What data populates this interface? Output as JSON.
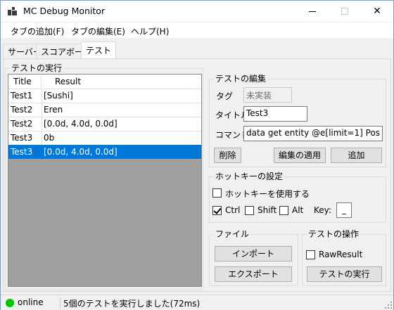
{
  "window": {
    "title": "MC Debug Monitor"
  },
  "menu": [
    "タブの追加(F)",
    "タブの編集(E)",
    "ヘルプ(H)"
  ],
  "tabs": [
    "サーバー",
    "スコアボード",
    "テスト"
  ],
  "run_group": {
    "label": "テストの実行",
    "columns": [
      "Title",
      "Result"
    ],
    "rows": [
      {
        "title": "Test1",
        "result": "[Sushi]",
        "selected": false
      },
      {
        "title": "Test2",
        "result": "Eren",
        "selected": false
      },
      {
        "title": "Test2",
        "result": "[0.0d, 4.0d, 0.0d]",
        "selected": false
      },
      {
        "title": "Test3",
        "result": "0b",
        "selected": false
      },
      {
        "title": "Test3",
        "result": "[0.0d, 4.0d, 0.0d]",
        "selected": true
      }
    ]
  },
  "edit_group": {
    "label": "テストの編集",
    "tag_label": "タグ",
    "tag_value": "未実装",
    "title_label": "タイトル",
    "title_value": "Test3",
    "command_label": "コマンド",
    "command_value": "data get entity @e[limit=1] Pos",
    "delete_button": "削除",
    "apply_button": "編集の適用",
    "add_button": "追加"
  },
  "hotkey_group": {
    "label": "ホットキーの設定",
    "use_hotkey_label": "ホットキーを使用する",
    "use_hotkey_checked": false,
    "ctrl_label": "Ctrl",
    "ctrl_checked": true,
    "shift_label": "Shift",
    "shift_checked": false,
    "alt_label": "Alt",
    "alt_checked": false,
    "key_label": "Key:",
    "key_value": "_"
  },
  "file_group": {
    "label": "ファイル",
    "import_button": "インポート",
    "export_button": "エクスポート"
  },
  "ops_group": {
    "label": "テストの操作",
    "raw_result_label": "RawResult",
    "raw_result_checked": false,
    "run_button": "テストの実行"
  },
  "status": {
    "connection": "online",
    "connection_color": "#00c800",
    "message": "5個のテストを実行しました(72ms)"
  }
}
